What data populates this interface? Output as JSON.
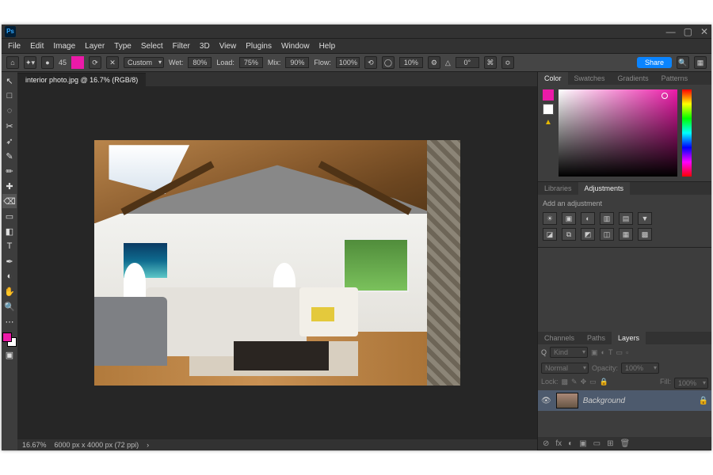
{
  "app": {
    "name": "Ps"
  },
  "winbtns": {
    "min": "—",
    "max": "▢",
    "close": "✕"
  },
  "menus": [
    "File",
    "Edit",
    "Image",
    "Layer",
    "Type",
    "Select",
    "Filter",
    "3D",
    "View",
    "Plugins",
    "Window",
    "Help"
  ],
  "options": {
    "brush_size": "45",
    "mode": "Custom",
    "wet_label": "Wet:",
    "wet": "80%",
    "load_label": "Load:",
    "load": "75%",
    "mix_label": "Mix:",
    "mix": "90%",
    "flow_label": "Flow:",
    "flow": "100%",
    "smoothing": "10%",
    "angle": "0°",
    "share": "Share"
  },
  "document": {
    "tab": "interior photo.jpg @ 16.7% (RGB/8)",
    "zoom": "16.67%",
    "info": "6000 px x 4000 px (72 ppi)"
  },
  "color_panel": {
    "tabs": [
      "Color",
      "Swatches",
      "Gradients",
      "Patterns"
    ],
    "active": 0
  },
  "adjust_panel": {
    "tabs": [
      "Libraries",
      "Adjustments"
    ],
    "active": 1,
    "hint": "Add an adjustment"
  },
  "layers_panel": {
    "tabs": [
      "Channels",
      "Paths",
      "Layers"
    ],
    "active": 2,
    "kind": "Kind",
    "blend": "Normal",
    "opacity_label": "Opacity:",
    "opacity": "100%",
    "lock_label": "Lock:",
    "fill_label": "Fill:",
    "fill": "100%",
    "layer_name": "Background"
  },
  "tools": [
    "↖",
    "□",
    "◌",
    "✂",
    "➶",
    "✎",
    "✏",
    "✚",
    "⌫",
    "▭",
    "◧",
    "T",
    "✒",
    "◐",
    "✋",
    "🔍"
  ],
  "adj_icons_row1": [
    "☀",
    "▣",
    "◐",
    "▥",
    "▤",
    "▼"
  ],
  "adj_icons_row2": [
    "◪",
    "⧉",
    "◩",
    "◫",
    "▦",
    "▩"
  ],
  "layer_bottom_icons": [
    "⊘",
    "fx",
    "◐",
    "▣",
    "▭",
    "⊞",
    "🗑"
  ]
}
